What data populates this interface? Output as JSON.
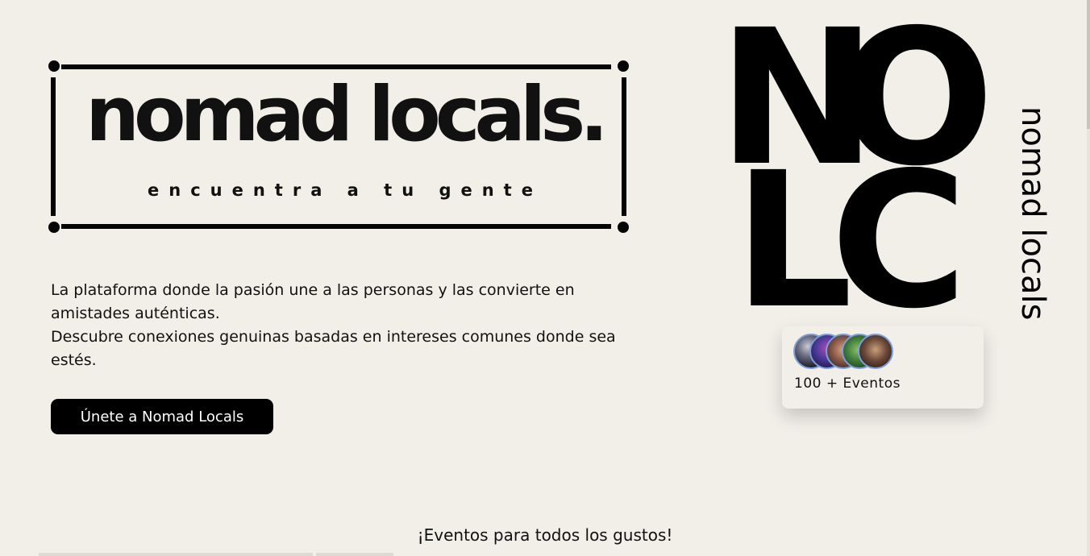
{
  "logo": {
    "wordmark": "nomad locals.",
    "tagline": "encuentra a tu gente"
  },
  "intro": {
    "line1": "La plataforma donde la pasión une a las personas y las convierte en amistades auténticas.",
    "line2": "Descubre conexiones genuinas basadas en intereses comunes donde sea estés."
  },
  "cta": {
    "join_label": "Únete a Nomad Locals"
  },
  "side_logo": {
    "letters": [
      "N",
      "O",
      "L",
      "C"
    ],
    "vertical_text": "nomad locals"
  },
  "events_card": {
    "count_label": "100 + Eventos",
    "avatars": [
      "event-crowd-photo",
      "event-party-photo",
      "event-group-photo",
      "event-outdoor-photo",
      "event-friends-photo"
    ]
  },
  "section": {
    "heading": "¡Eventos para todos los gustos!"
  },
  "colors": {
    "background": "#f2efe9",
    "ink": "#000000",
    "avatar_border": "#7d9fd8"
  }
}
